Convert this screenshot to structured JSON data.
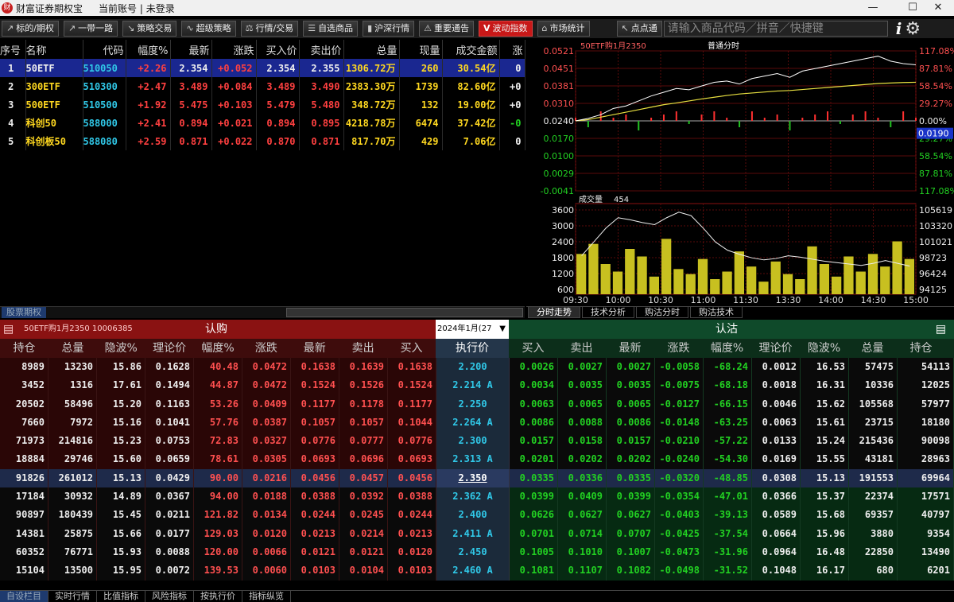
{
  "titlebar": {
    "app": "财富证券期权宝",
    "account": "当前账号 | 未登录",
    "minimize": "—",
    "maximize": "☐",
    "close": "✕"
  },
  "toolbar": {
    "buttons": [
      "标的/期权",
      "一带一路",
      "策略交易",
      "超级策略",
      "行情/交易",
      "自选商品",
      "沪深行情",
      "重要通告",
      "波动指数",
      "市场统计",
      "点点通"
    ],
    "search_placeholder": "请输入商品代码／拼音／快捷键"
  },
  "quote_table": {
    "headers": [
      "序号",
      "名称",
      "代码",
      "幅度%",
      "最新",
      "涨跌",
      "买入价",
      "卖出价",
      "总量",
      "现量",
      "成交金额",
      "涨"
    ],
    "rows": [
      [
        "1",
        "50ETF",
        "510050",
        "+2.26",
        "2.354",
        "+0.052",
        "2.354",
        "2.355",
        "1306.72万",
        "260",
        "30.54亿",
        "0"
      ],
      [
        "2",
        "300ETF",
        "510300",
        "+2.47",
        "3.489",
        "+0.084",
        "3.489",
        "3.490",
        "2383.30万",
        "1739",
        "82.60亿",
        "+0"
      ],
      [
        "3",
        "500ETF",
        "510500",
        "+1.92",
        "5.475",
        "+0.103",
        "5.479",
        "5.480",
        "348.72万",
        "132",
        "19.00亿",
        "+0"
      ],
      [
        "4",
        "科创50",
        "588000",
        "+2.41",
        "0.894",
        "+0.021",
        "0.894",
        "0.895",
        "4218.78万",
        "6474",
        "37.42亿",
        "-0"
      ],
      [
        "5",
        "科创板50",
        "588080",
        "+2.59",
        "0.871",
        "+0.022",
        "0.870",
        "0.871",
        "817.70万",
        "429",
        "7.06亿",
        "0"
      ]
    ]
  },
  "left_tab": "股票期权",
  "chart_data": {
    "type": "line",
    "title": "50ETF购1月2350",
    "mode": "普通分时",
    "x_ticks": [
      "09:30",
      "10:00",
      "10:30",
      "11:00",
      "11:30",
      "13:30",
      "14:00",
      "14:30",
      "15:00"
    ],
    "price_ticks": [
      "0.0521",
      "0.0451",
      "0.0381",
      "0.0310",
      "0.0240",
      "0.0170",
      "0.0100",
      "0.0029",
      "-0.0041"
    ],
    "pct_ticks": [
      "117.08%",
      "87.81%",
      "58.54%",
      "29.27%",
      "0.00%",
      "29.27%",
      "58.54%",
      "87.81%",
      "117.08%"
    ],
    "current_price": "0.0190",
    "ylim": [
      -0.0041,
      0.0521
    ],
    "price": [
      0.024,
      0.025,
      0.0265,
      0.029,
      0.03,
      0.032,
      0.034,
      0.0355,
      0.037,
      0.0365,
      0.038,
      0.0395,
      0.04,
      0.0388,
      0.041,
      0.042,
      0.043,
      0.0415,
      0.044,
      0.045,
      0.046,
      0.047,
      0.048,
      0.049,
      0.05,
      0.048,
      0.047,
      0.0465
    ],
    "avg": [
      0.024,
      0.0245,
      0.0255,
      0.0265,
      0.0275,
      0.0285,
      0.0295,
      0.0305,
      0.0312,
      0.032,
      0.0328,
      0.0335,
      0.0342,
      0.0348,
      0.0352,
      0.0356,
      0.036,
      0.0362,
      0.0366,
      0.037,
      0.0374,
      0.0378,
      0.0382,
      0.0386,
      0.039,
      0.0392,
      0.0394,
      0.0395
    ],
    "volume_label": "成交量",
    "volume_value": "454",
    "vol_ticks": [
      "3600",
      "3000",
      "2400",
      "1800",
      "1200",
      "600"
    ],
    "oi_ticks": [
      "105619",
      "103320",
      "101021",
      "98723",
      "96424",
      "94125"
    ],
    "vol_ylim": [
      0,
      3600
    ],
    "volume": [
      1600,
      2000,
      1200,
      900,
      1800,
      1500,
      700,
      2200,
      1000,
      800,
      1400,
      600,
      900,
      1700,
      1100,
      500,
      1300,
      800,
      600,
      1900,
      1200,
      700,
      1500,
      900,
      1600,
      1100,
      2100,
      1400
    ],
    "oi_ylim": [
      94125,
      105619
    ],
    "oi": [
      99000,
      101000,
      103000,
      104500,
      104200,
      103800,
      103500,
      104500,
      105300,
      104800,
      103000,
      101000,
      99800,
      99200,
      98700,
      98400,
      98600,
      99000,
      98800,
      98500,
      98200,
      98000,
      97800,
      97600,
      97900,
      98300,
      97900,
      97500
    ]
  },
  "chart_tabs": [
    "分时走势",
    "技术分析",
    "购沽分时",
    "购沽技术"
  ],
  "option_table": {
    "call_title": "50ETF购1月2350  10006385",
    "call_label": "认购",
    "expiry": "2024年1月(27",
    "put_label": "认沽",
    "call_headers": [
      "持仓",
      "总量",
      "隐波%",
      "理论价",
      "幅度%",
      "涨跌",
      "最新",
      "卖出",
      "买入"
    ],
    "strike_header": "执行价",
    "put_headers": [
      "买入",
      "卖出",
      "最新",
      "涨跌",
      "幅度%",
      "理论价",
      "隐波%",
      "总量",
      "持仓"
    ],
    "rows": [
      {
        "call": [
          "8989",
          "13230",
          "15.86",
          "0.1628",
          "40.48",
          "0.0472",
          "0.1638",
          "0.1639",
          "0.1638"
        ],
        "strike": "2.200",
        "put": [
          "0.0026",
          "0.0027",
          "0.0027",
          "-0.0058",
          "-68.24",
          "0.0012",
          "16.53",
          "57475",
          "54113"
        ]
      },
      {
        "call": [
          "3452",
          "1316",
          "17.61",
          "0.1494",
          "44.87",
          "0.0472",
          "0.1524",
          "0.1526",
          "0.1524"
        ],
        "strike": "2.214 A",
        "put": [
          "0.0034",
          "0.0035",
          "0.0035",
          "-0.0075",
          "-68.18",
          "0.0018",
          "16.31",
          "10336",
          "12025"
        ]
      },
      {
        "call": [
          "20502",
          "58496",
          "15.20",
          "0.1163",
          "53.26",
          "0.0409",
          "0.1177",
          "0.1178",
          "0.1177"
        ],
        "strike": "2.250",
        "put": [
          "0.0063",
          "0.0065",
          "0.0065",
          "-0.0127",
          "-66.15",
          "0.0046",
          "15.62",
          "105568",
          "57977"
        ]
      },
      {
        "call": [
          "7660",
          "7972",
          "15.16",
          "0.1041",
          "57.76",
          "0.0387",
          "0.1057",
          "0.1057",
          "0.1044"
        ],
        "strike": "2.264 A",
        "put": [
          "0.0086",
          "0.0088",
          "0.0086",
          "-0.0148",
          "-63.25",
          "0.0063",
          "15.61",
          "23715",
          "18180"
        ]
      },
      {
        "call": [
          "71973",
          "214816",
          "15.23",
          "0.0753",
          "72.83",
          "0.0327",
          "0.0776",
          "0.0777",
          "0.0776"
        ],
        "strike": "2.300",
        "put": [
          "0.0157",
          "0.0158",
          "0.0157",
          "-0.0210",
          "-57.22",
          "0.0133",
          "15.24",
          "215436",
          "90098"
        ]
      },
      {
        "call": [
          "18884",
          "29746",
          "15.60",
          "0.0659",
          "78.61",
          "0.0305",
          "0.0693",
          "0.0696",
          "0.0693"
        ],
        "strike": "2.313 A",
        "put": [
          "0.0201",
          "0.0202",
          "0.0202",
          "-0.0240",
          "-54.30",
          "0.0169",
          "15.55",
          "43181",
          "28963"
        ]
      },
      {
        "call": [
          "91826",
          "261012",
          "15.13",
          "0.0429",
          "90.00",
          "0.0216",
          "0.0456",
          "0.0457",
          "0.0456"
        ],
        "strike": "2.350",
        "put": [
          "0.0335",
          "0.0336",
          "0.0335",
          "-0.0320",
          "-48.85",
          "0.0308",
          "15.13",
          "191553",
          "69964"
        ]
      },
      {
        "call": [
          "17184",
          "30932",
          "14.89",
          "0.0367",
          "94.00",
          "0.0188",
          "0.0388",
          "0.0392",
          "0.0388"
        ],
        "strike": "2.362 A",
        "put": [
          "0.0399",
          "0.0409",
          "0.0399",
          "-0.0354",
          "-47.01",
          "0.0366",
          "15.37",
          "22374",
          "17571"
        ]
      },
      {
        "call": [
          "90897",
          "180439",
          "15.45",
          "0.0211",
          "121.82",
          "0.0134",
          "0.0244",
          "0.0245",
          "0.0244"
        ],
        "strike": "2.400",
        "put": [
          "0.0626",
          "0.0627",
          "0.0627",
          "-0.0403",
          "-39.13",
          "0.0589",
          "15.68",
          "69357",
          "40797"
        ]
      },
      {
        "call": [
          "14381",
          "25875",
          "15.66",
          "0.0177",
          "129.03",
          "0.0120",
          "0.0213",
          "0.0214",
          "0.0213"
        ],
        "strike": "2.411 A",
        "put": [
          "0.0701",
          "0.0714",
          "0.0707",
          "-0.0425",
          "-37.54",
          "0.0664",
          "15.96",
          "3880",
          "9354"
        ]
      },
      {
        "call": [
          "60352",
          "76771",
          "15.93",
          "0.0088",
          "120.00",
          "0.0066",
          "0.0121",
          "0.0121",
          "0.0120"
        ],
        "strike": "2.450",
        "put": [
          "0.1005",
          "0.1010",
          "0.1007",
          "-0.0473",
          "-31.96",
          "0.0964",
          "16.48",
          "22850",
          "13490"
        ]
      },
      {
        "call": [
          "15104",
          "13500",
          "15.95",
          "0.0072",
          "139.53",
          "0.0060",
          "0.0103",
          "0.0104",
          "0.0103"
        ],
        "strike": "2.460 A",
        "put": [
          "0.1081",
          "0.1107",
          "0.1082",
          "-0.0498",
          "-31.52",
          "0.1048",
          "16.17",
          "680",
          "6201"
        ]
      }
    ]
  },
  "bottom_tabs": [
    "自设栏目",
    "实时行情",
    "比值指标",
    "风险指标",
    "按执行价",
    "指标纵览"
  ]
}
